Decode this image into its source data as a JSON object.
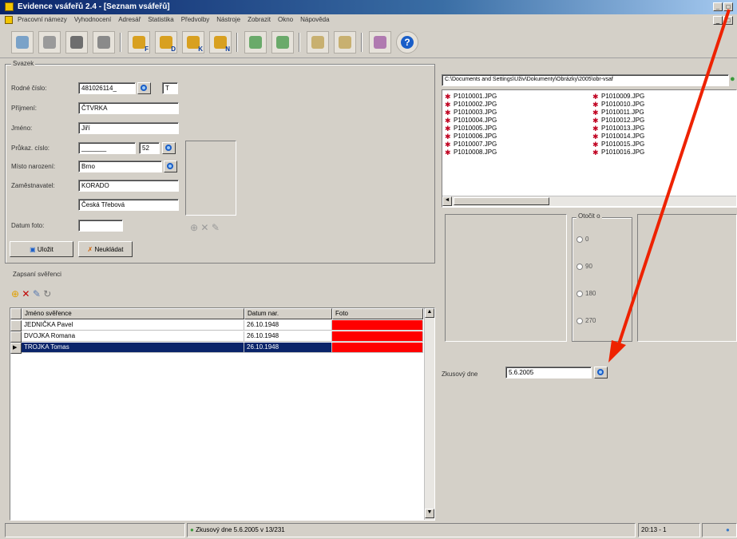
{
  "window": {
    "title": "Evidence vsáfeřů 2.4 - [Seznam vsáfeřů]"
  },
  "menu": [
    "Pracovní námezy",
    "Vyhodnocení",
    "Adresář",
    "Statistika",
    "Předvolby",
    "Nástroje",
    "Zobrazit",
    "Okno",
    "Nápověda"
  ],
  "toolbar": {
    "letters": [
      "F",
      "D",
      "K",
      "N"
    ],
    "help": "?"
  },
  "group": {
    "legend": "Svazek",
    "rodne_cislo_label": "Rodné číslo:",
    "rodne_cislo_value": "481026114_",
    "t_value": "T",
    "prijmeni_label": "Příjmení:",
    "prijmeni_value": "ČTVRKA",
    "jmeno_label": "Jméno:",
    "jmeno_value": "Jiří",
    "prukaz_label": "Průkaz. císlo:",
    "prukaz_value": "_______",
    "prukaz_suffix": "52",
    "misto_label": "Místo narození:",
    "misto_value": "Brno",
    "zamestnavatel_label": "Zaměstnavatel:",
    "zamestnavatel_value": "KORADO",
    "zamestnavatel_value2": "Česká Třebová",
    "datum_label": "Datum foto:",
    "datum_value": "",
    "save_label": "Uložit",
    "dont_save_label": "Neukládat"
  },
  "zapis": {
    "legend": "Zapsaní svěřenci",
    "columns": [
      "Jméno svěřence",
      "Datum nar.",
      "Foto"
    ],
    "rows": [
      {
        "name": "JEDNIČKA Pavel",
        "date": "26.10.1948",
        "selected": false
      },
      {
        "name": "DVOJKA Romana",
        "date": "26.10.1948",
        "selected": false
      },
      {
        "name": "TROJKA Tomas",
        "date": "26.10.1948",
        "selected": true
      }
    ]
  },
  "right": {
    "path": "C:\\Documents and Settings\\Uživ\\Dokumenty\\Obrázky\\2005\\obr-vsaf",
    "files_col1": [
      "P1010001.JPG",
      "P1010002.JPG",
      "P1010003.JPG",
      "P1010004.JPG",
      "P1010005.JPG",
      "P1010006.JPG",
      "P1010007.JPG",
      "P1010008.JPG"
    ],
    "files_col2": [
      "P1010009.JPG",
      "P1010010.JPG",
      "P1010011.JPG",
      "P1010012.JPG",
      "P1010013.JPG",
      "P1010014.JPG",
      "P1010015.JPG",
      "P1010016.JPG"
    ],
    "rotation_legend": "Otočit o",
    "rotation_options": [
      "0",
      "90",
      "180",
      "270"
    ],
    "zpracovany_label": "Zkusový dne",
    "zpracovany_value": "5.6.2005"
  },
  "statusbar": {
    "center_text": "Zkusový dne 5.6.2005 v 13/231",
    "right_text": "20:13 - 1"
  },
  "colors": {
    "arrow": "#ee2200",
    "photo_missing": "#ff0000",
    "selection": "#0a246a"
  }
}
